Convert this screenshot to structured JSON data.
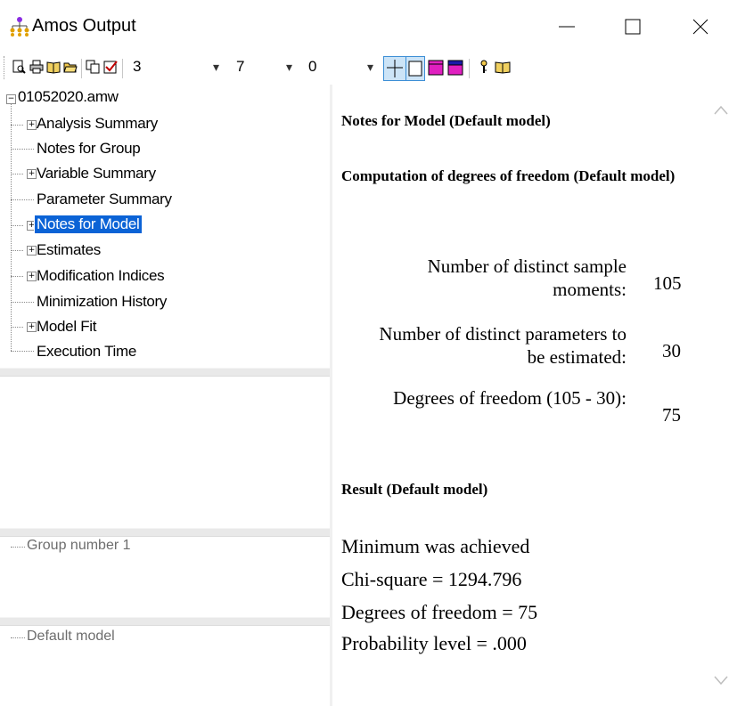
{
  "window": {
    "title": "Amos Output",
    "controls": {
      "minimize": "minimize",
      "maximize": "maximize",
      "close": "close"
    }
  },
  "toolbar": {
    "icons": [
      "print-preview-icon",
      "print-icon",
      "book-icon",
      "open-folder-icon",
      "copy-icon",
      "checkbox-icon"
    ],
    "combo1": "3",
    "combo2": "7",
    "combo3": "0",
    "tools": [
      "table-grid-icon",
      "table-outline-icon",
      "magenta-table-icon",
      "purple-table-icon",
      "key-icon",
      "help-book-icon"
    ]
  },
  "tree": {
    "root": "01052020.amw",
    "items": [
      {
        "label": "Analysis Summary",
        "expandable": true,
        "selected": false
      },
      {
        "label": "Notes for Group",
        "expandable": false,
        "selected": false
      },
      {
        "label": "Variable Summary",
        "expandable": true,
        "selected": false
      },
      {
        "label": "Parameter Summary",
        "expandable": false,
        "selected": false
      },
      {
        "label": "Notes for Model",
        "expandable": true,
        "selected": true
      },
      {
        "label": "Estimates",
        "expandable": true,
        "selected": false
      },
      {
        "label": "Modification Indices",
        "expandable": true,
        "selected": false
      },
      {
        "label": "Minimization History",
        "expandable": false,
        "selected": false
      },
      {
        "label": "Model Fit",
        "expandable": true,
        "selected": false
      },
      {
        "label": "Execution Time",
        "expandable": false,
        "selected": false
      }
    ]
  },
  "groups": {
    "item": "Group number 1"
  },
  "models": {
    "item": "Default model"
  },
  "content": {
    "heading1": "Notes for Model (Default model)",
    "heading2": "Computation of degrees of freedom (Default model)",
    "rows": [
      {
        "label": "Number of distinct sample moments:",
        "value": "105"
      },
      {
        "label": "Number of distinct parameters to be estimated:",
        "value": "30"
      },
      {
        "label": "Degrees of freedom (105 - 30):",
        "value": "75"
      }
    ],
    "heading3": "Result (Default model)",
    "result": [
      "Minimum was achieved",
      "Chi-square = 1294.796",
      "Degrees of freedom = 75",
      "Probability level = .000"
    ]
  },
  "colors": {
    "selection": "#0b63d6",
    "magenta": "#e020c0",
    "purple": "#7a1fa2"
  }
}
